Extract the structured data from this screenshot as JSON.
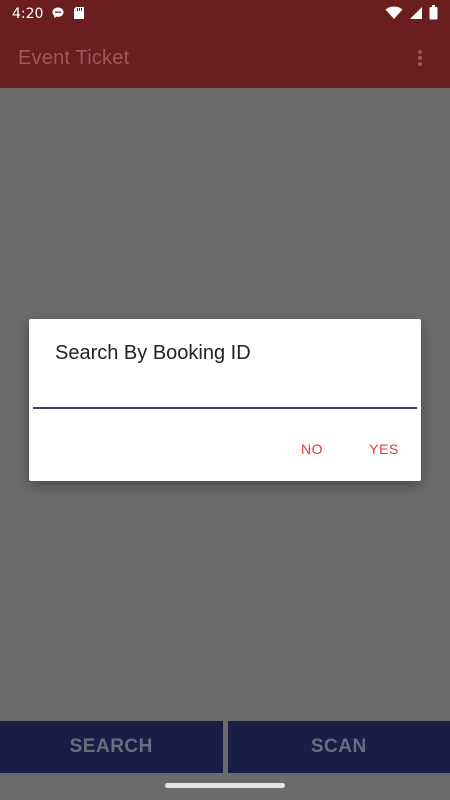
{
  "status_bar": {
    "time": "4:20",
    "icons": [
      "chat-bubble-icon",
      "sd-card-icon",
      "wifi-icon",
      "cell-signal-icon",
      "battery-icon"
    ]
  },
  "app_bar": {
    "title": "Event Ticket",
    "menu_icon": "overflow-menu-icon"
  },
  "dialog": {
    "title": "Search By Booking ID",
    "input_value": "",
    "no_label": "NO",
    "yes_label": "YES"
  },
  "bottom_bar": {
    "search_label": "SEARCH",
    "scan_label": "SCAN"
  },
  "colors": {
    "app_bar": "#6b1e1e",
    "bottom_button": "#1a1e46",
    "dialog_action": "#e53935",
    "scrim": "#6b6b6b"
  }
}
